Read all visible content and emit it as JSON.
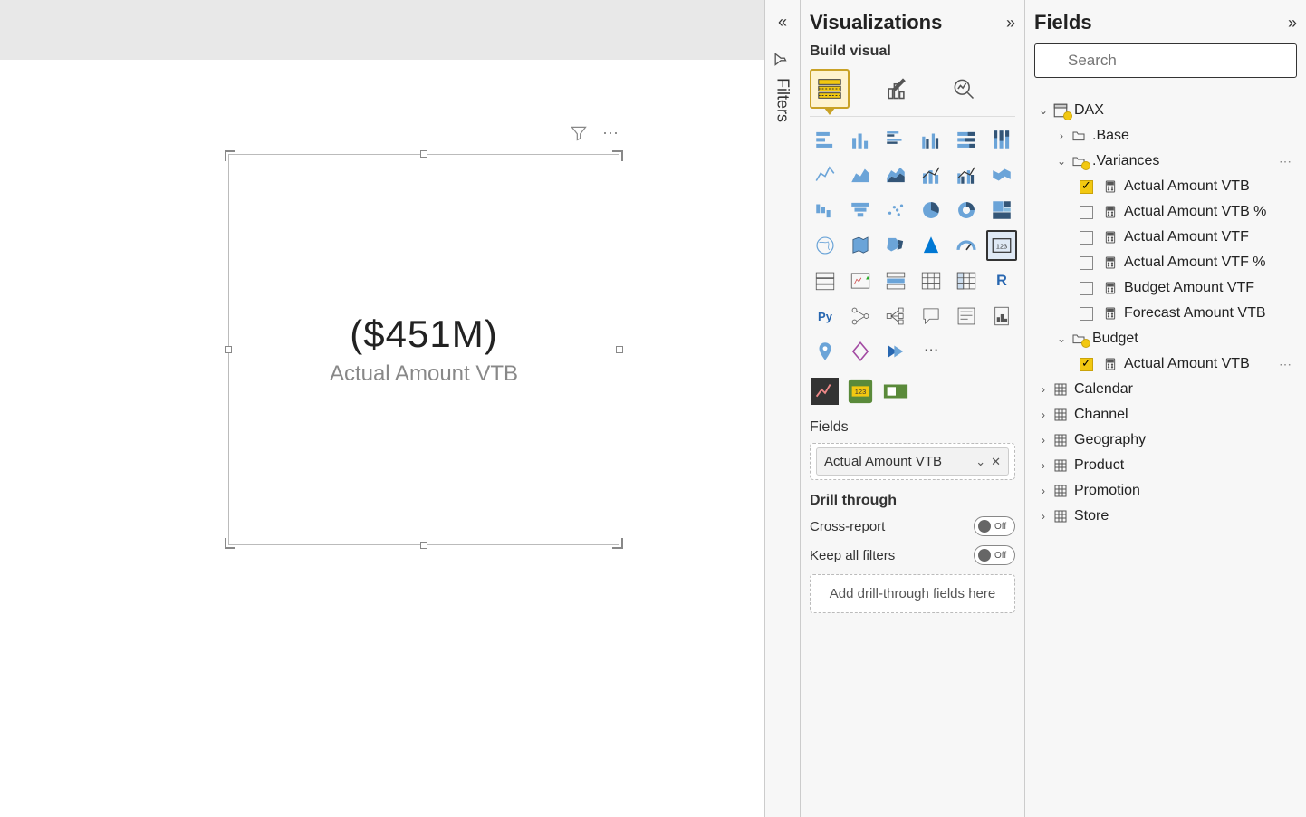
{
  "canvas": {
    "card": {
      "value": "($451M)",
      "label": "Actual Amount VTB"
    }
  },
  "filters": {
    "rail_label": "Filters"
  },
  "viz": {
    "title": "Visualizations",
    "build_label": "Build visual",
    "fields_section": "Fields",
    "field_chip": "Actual Amount VTB",
    "drill_section": "Drill through",
    "cross_report": "Cross-report",
    "keep_filters": "Keep all filters",
    "toggle_off": "Off",
    "dropzone": "Add drill-through fields here"
  },
  "fields": {
    "title": "Fields",
    "search_placeholder": "Search",
    "tables": {
      "dax": "DAX",
      "base": ".Base",
      "variances": ".Variances",
      "variances_items": [
        {
          "name": "Actual Amount VTB",
          "checked": true
        },
        {
          "name": "Actual Amount VTB %",
          "checked": false
        },
        {
          "name": "Actual Amount VTF",
          "checked": false
        },
        {
          "name": "Actual Amount VTF %",
          "checked": false
        },
        {
          "name": "Budget Amount VTF",
          "checked": false
        },
        {
          "name": "Forecast Amount VTB",
          "checked": false
        }
      ],
      "budget": "Budget",
      "budget_items": [
        {
          "name": "Actual Amount VTB",
          "checked": true
        }
      ],
      "calendar": "Calendar",
      "channel": "Channel",
      "geography": "Geography",
      "product": "Product",
      "promotion": "Promotion",
      "store": "Store"
    }
  }
}
